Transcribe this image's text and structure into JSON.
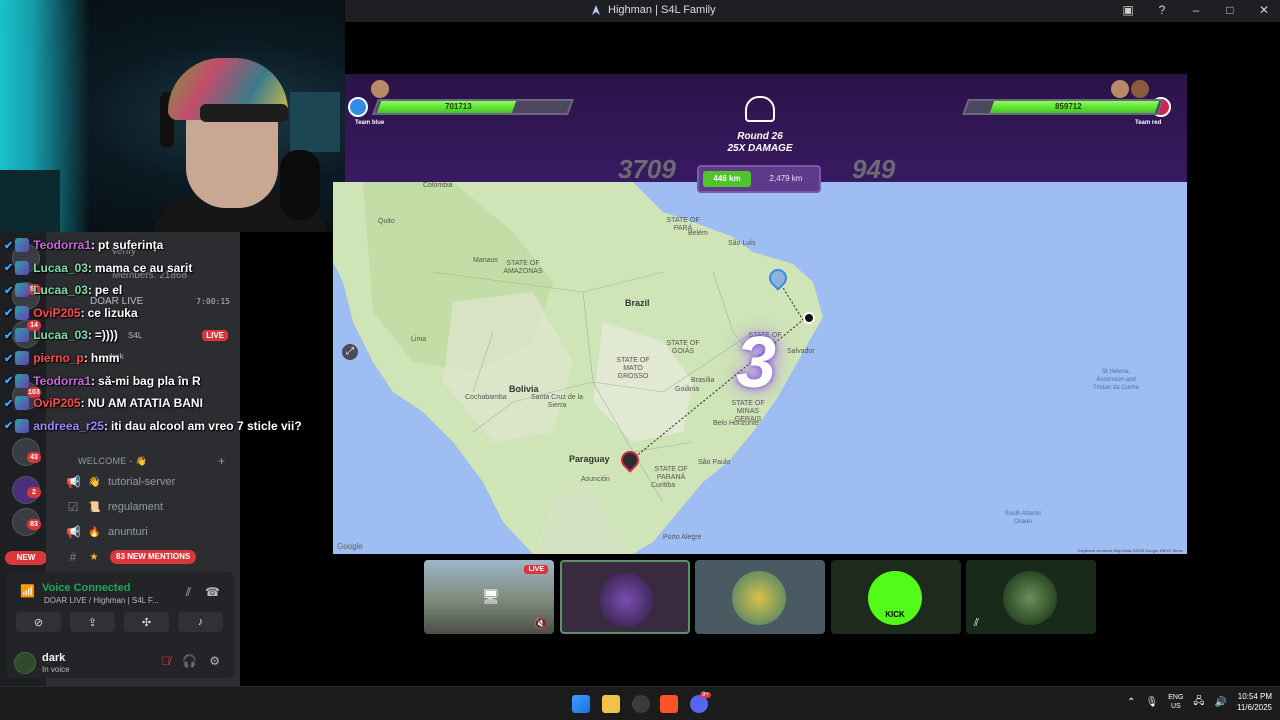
{
  "window": {
    "title": "Highman | S4L Family"
  },
  "chat": [
    {
      "user": "Teodorra1",
      "text": "pt suferința",
      "color": "#c76bd8"
    },
    {
      "user": "Lucaa_03",
      "text": "mama ce au sarit",
      "color": "#7fe0a8"
    },
    {
      "user": "Lucaa_03",
      "text": "pe el",
      "color": "#7fe0a8"
    },
    {
      "user": "OviP205",
      "text": "ce lizuka",
      "color": "#ff4d4d"
    },
    {
      "user": "Lucaa_03",
      "text": "=))))",
      "color": "#7fe0a8"
    },
    {
      "user": "pierno_p",
      "text": "hmm",
      "color": "#ff4d4d"
    },
    {
      "user": "Teodorra1",
      "text": "să-mi bag pla în R",
      "color": "#c76bd8"
    },
    {
      "user": "OviP205",
      "text": "NU AM ATATIA BANI",
      "color": "#ff4d4d"
    },
    {
      "user": "andreea_r25",
      "text": "iti dau alcool am vreo 7 sticle vii?",
      "color": "#a884ff"
    }
  ],
  "discord": {
    "faded": {
      "verify": "verify",
      "members": "Members: 21868"
    },
    "voice_channel": {
      "name": "DOAR LIVE",
      "time": "7:00:15",
      "user1": "S4L",
      "live": "LIVE",
      "user2": "dark"
    },
    "category": "WELCOME - 👋",
    "channels": [
      {
        "name": "tutorial-server",
        "emoji": "👋"
      },
      {
        "name": "regulament",
        "emoji": "📜"
      },
      {
        "name": "anunturi",
        "emoji": "🔥"
      }
    ],
    "mentions": "83 NEW MENTIONS",
    "new_pill": "NEW",
    "server_badges": [
      "57",
      "14",
      "103",
      "43",
      "2",
      "83"
    ],
    "voice_panel": {
      "status": "Voice Connected",
      "sub": "DOAR LIVE / Highman | S4L F..."
    },
    "user": {
      "name": "dark",
      "status": "In voice"
    }
  },
  "game": {
    "team_blue": {
      "hp": "701713",
      "label": "Team blue",
      "hp_fraction": 0.72
    },
    "team_red": {
      "hp": "859712",
      "label": "Team red",
      "hp_fraction": 0.88
    },
    "round": "Round 26",
    "damage": "25X DAMAGE",
    "score_left": "3709",
    "score_right": "949",
    "dist_left": "446 km",
    "dist_right": "2,479 km",
    "countdown": "3"
  },
  "map": {
    "labels": {
      "brazil": "Brazil",
      "bolivia": "Bolivia",
      "paraguay": "Paraguay",
      "colombia": "Colombia",
      "quito": "Quito",
      "lima": "Lima",
      "cochabamba": "Cochabamba",
      "santa_cruz": "Santa Cruz de la Sierra",
      "brasilia": "Brasília",
      "goiania": "Goiânia",
      "belo_horizonte": "Belo Horizonte",
      "salvador": "Salvador",
      "sao_luis": "São Luís",
      "belem": "Belém",
      "manaus": "Manaus",
      "sao_paulo": "São Paulo",
      "curitiba": "Curitiba",
      "porto_alegre": "Porto Alegre",
      "asuncion": "Asunción",
      "st_helena": "St Helena, Ascension and Tristan da Cunha",
      "atlantic": "South Atlantic Ocean",
      "state_para": "STATE OF PARÁ",
      "state_amazonas": "STATE OF AMAZONAS",
      "state_mato_grosso": "STATE OF MATO GROSSO",
      "state_bahia": "STATE OF BAHIA",
      "state_minas": "STATE OF MINAS GERAIS",
      "state_goias": "STATE OF GOIÁS",
      "state_parana": "STATE OF PARANÁ"
    },
    "google": "Google",
    "attribution": "Keyboard shortcuts   Map Data ©2025 Google, INEGI   Terms"
  },
  "tiles": {
    "live": "LIVE",
    "kick": "KICK"
  },
  "taskbar": {
    "lang1": "ENG",
    "lang2": "US",
    "time": "10:54 PM",
    "date": "11/6/2025",
    "discord_badge": "9+"
  }
}
